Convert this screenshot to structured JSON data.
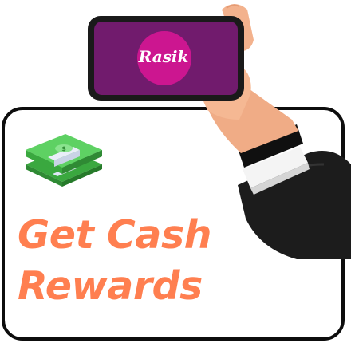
{
  "headline": {
    "line1": "Get Cash",
    "line2": "Rewards"
  },
  "app_logo": {
    "text": "Rasik"
  },
  "colors": {
    "headline": "#ff7f50",
    "phone_screen": "#6a1a66",
    "logo_circle": "#c2148a",
    "money": "#4bc44f",
    "sleeve": "#1e1e1e",
    "skin": "#f2b08c"
  },
  "icons": [
    "money-stack-icon",
    "hand-holding-phone-illustration",
    "app-logo-icon"
  ]
}
